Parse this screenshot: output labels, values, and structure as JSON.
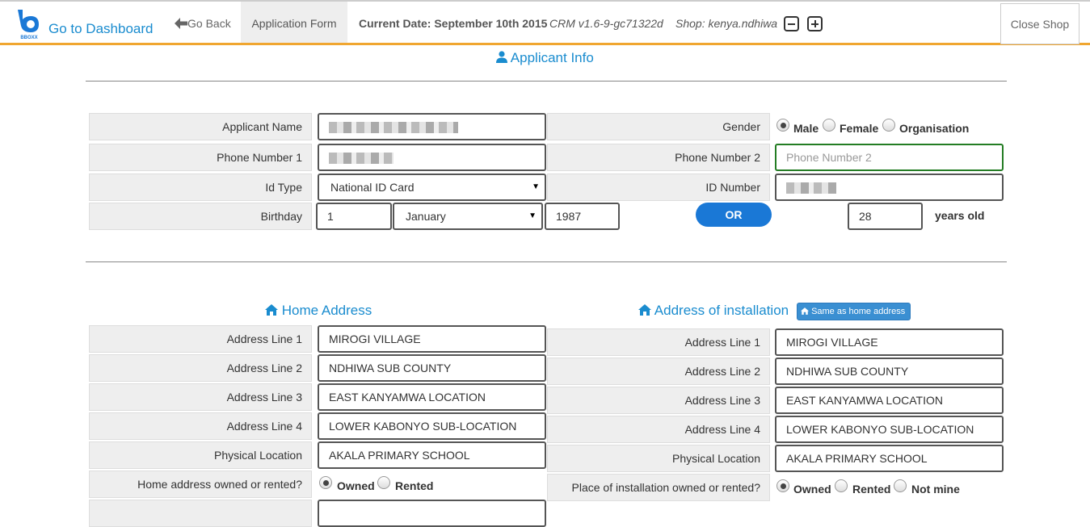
{
  "header": {
    "brand_label": "Go to Dashboard",
    "logo_text": "BBOXX",
    "go_back_label": "Go Back",
    "application_form_label": "Application Form",
    "current_date": "Current Date: September 10th 2015",
    "crm_version": "CRM v1.6-9-gc71322d",
    "shop": "Shop: kenya.ndhiwa",
    "close_shop_label": "Close Shop"
  },
  "applicant": {
    "section_title": "Applicant Info",
    "applicant_name_label": "Applicant Name",
    "phone1_label": "Phone Number 1",
    "id_type_label": "Id Type",
    "id_type_value": "National ID Card",
    "birthday_label": "Birthday",
    "birth_day": "1",
    "birth_month": "January",
    "birth_year": "1987",
    "or_label": "OR",
    "age_value": "28",
    "years_old_label": "years old",
    "gender_label": "Gender",
    "gender_options": [
      "Male",
      "Female",
      "Organisation"
    ],
    "gender_selected": "Male",
    "phone2_label": "Phone Number 2",
    "phone2_placeholder": "Phone Number 2",
    "id_number_label": "ID Number"
  },
  "home_address": {
    "section_title": "Home Address",
    "line1_label": "Address Line 1",
    "line1_value": "MIROGI VILLAGE",
    "line2_label": "Address Line 2",
    "line2_value": "NDHIWA SUB COUNTY",
    "line3_label": "Address Line 3",
    "line3_value": "EAST KANYAMWA LOCATION",
    "line4_label": "Address Line 4",
    "line4_value": "LOWER KABONYO SUB-LOCATION",
    "physical_label": "Physical Location",
    "physical_value": "AKALA PRIMARY SCHOOL",
    "owned_label": "Home address owned or rented?",
    "owned_options": [
      "Owned",
      "Rented"
    ],
    "owned_selected": "Owned"
  },
  "installation_address": {
    "section_title": "Address of installation",
    "same_as_home_label": "Same as home address",
    "line1_label": "Address Line 1",
    "line1_value": "MIROGI VILLAGE",
    "line2_label": "Address Line 2",
    "line2_value": "NDHIWA SUB COUNTY",
    "line3_label": "Address Line 3",
    "line3_value": "EAST KANYAMWA LOCATION",
    "line4_label": "Address Line 4",
    "line4_value": "LOWER KABONYO SUB-LOCATION",
    "physical_label": "Physical Location",
    "physical_value": "AKALA PRIMARY SCHOOL",
    "owned_label": "Place of installation owned or rented?",
    "owned_options": [
      "Owned",
      "Rented",
      "Not mine"
    ],
    "owned_selected": "Owned"
  },
  "colors": {
    "accent": "#1a8ccf",
    "header_border": "#f0a630",
    "or_button": "#1a78d6"
  },
  "icons": [
    "back-arrow-icon",
    "user-icon",
    "home-icon",
    "zoom-out-icon",
    "zoom-in-icon"
  ]
}
